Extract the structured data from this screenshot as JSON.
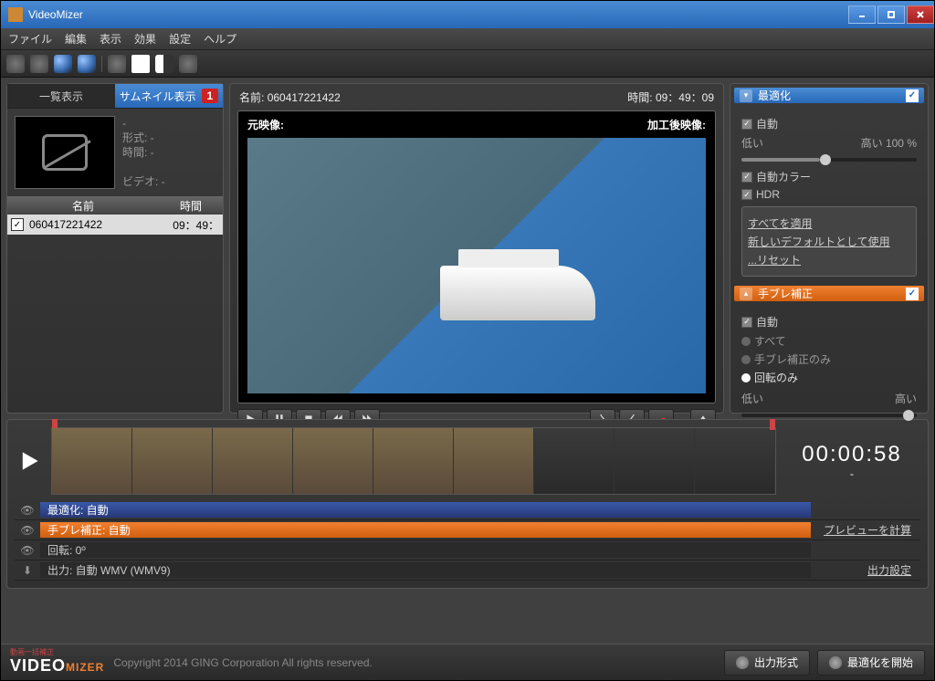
{
  "window": {
    "title": "VideoMizer"
  },
  "menu": {
    "file": "ファイル",
    "edit": "編集",
    "view": "表示",
    "effect": "効果",
    "settings": "設定",
    "help": "ヘルプ"
  },
  "sidebar": {
    "tabs": {
      "list": "一覧表示",
      "thumb": "サムネイル表示",
      "badge": "1"
    },
    "meta": {
      "dash": "-",
      "format": "形式: -",
      "duration": "時間: -",
      "video": "ビデオ: -"
    },
    "header": {
      "name": "名前",
      "time": "時間"
    },
    "row": {
      "name": "060417221422",
      "time": "09：49："
    }
  },
  "preview": {
    "name_label": "名前:",
    "name": "060417221422",
    "time_label": "時間:",
    "time": "09：49：09",
    "original": "元映像:",
    "processed": "加工後映像:"
  },
  "optimize": {
    "title": "最適化",
    "auto": "自動",
    "low": "低い",
    "high": "高い 100 %",
    "auto_color": "自動カラー",
    "hdr": "HDR",
    "apply_all": "すべてを適用",
    "save_default": "新しいデフォルトとして使用",
    "reset": "...リセット"
  },
  "stabilize": {
    "title": "手ブレ補正",
    "auto": "自動",
    "all": "すべて",
    "stab_only": "手ブレ補正のみ",
    "rotate_only": "回転のみ",
    "low": "低い",
    "high": "高い"
  },
  "timeline": {
    "timecode": "00:00:58",
    "dash": "-"
  },
  "tracks": {
    "opt": "最適化: 自動",
    "stab": "手ブレ補正: 自動",
    "rotate": "回転: 0º",
    "output": "出力: 自動 WMV (WMV9)",
    "preview_calc": "プレビューを計算",
    "output_settings": "出力設定"
  },
  "footer": {
    "copyright": "Copyright 2014 GING Corporation All rights reserved.",
    "output_format": "出力形式",
    "start_optimize": "最適化を開始",
    "logo_sub": "動画一括補正"
  }
}
